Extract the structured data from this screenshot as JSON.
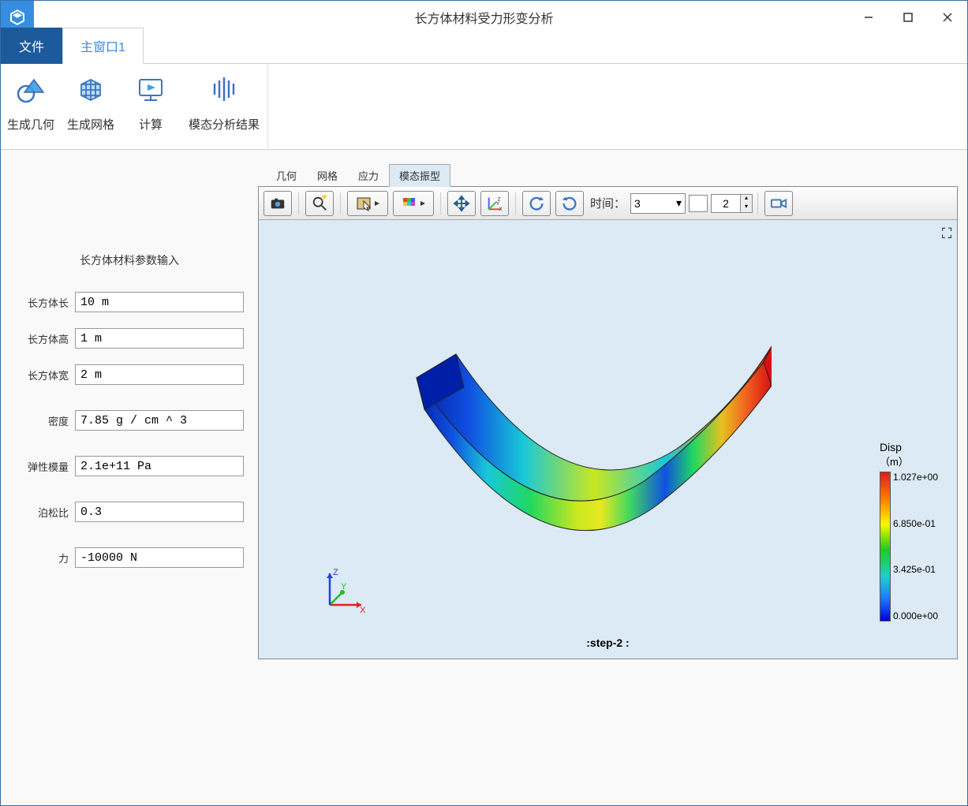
{
  "window": {
    "title": "长方体材料受力形变分析"
  },
  "ribbon": {
    "file_tab": "文件",
    "main_tab": "主窗口1",
    "buttons": {
      "gen_geom": "生成几何",
      "gen_mesh": "生成网格",
      "compute": "计算",
      "modal_result": "模态分析结果"
    }
  },
  "sidebar": {
    "title": "长方体材料参数输入",
    "params": {
      "length_label": "长方体长",
      "length_value": "10 m",
      "height_label": "长方体高",
      "height_value": "1 m",
      "width_label": "长方体宽",
      "width_value": "2 m",
      "density_label": "密度",
      "density_value": "7.85 g / cm ^ 3",
      "emod_label": "弹性模量",
      "emod_value": "2.1e+11 Pa",
      "poisson_label": "泊松比",
      "poisson_value": "0.3",
      "force_label": "力",
      "force_value": "-10000 N"
    }
  },
  "view": {
    "tabs": {
      "geom": "几何",
      "mesh": "网格",
      "stress": "应力",
      "modal": "模态振型"
    },
    "toolbar": {
      "time_label": "时间：",
      "time_value": "3",
      "spin_value": "2"
    },
    "step_label": ":step-2 :",
    "legend": {
      "title": "Disp",
      "unit": "（m）",
      "t0": "1.027e+00",
      "t1": "6.850e-01",
      "t2": "3.425e-01",
      "t3": "0.000e+00"
    }
  }
}
